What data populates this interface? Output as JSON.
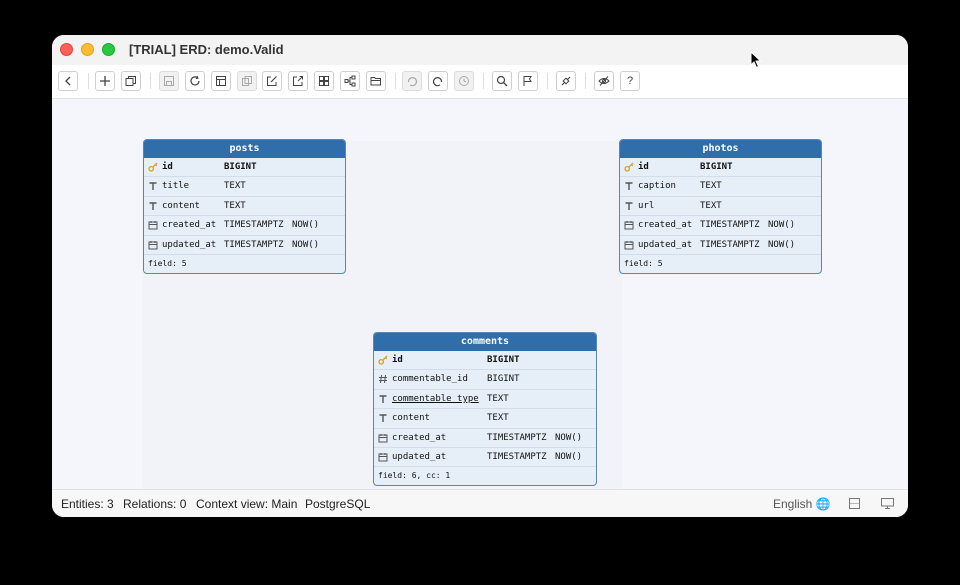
{
  "window": {
    "title": "[TRIAL] ERD: demo.Valid"
  },
  "toolbar": {
    "buttons": [
      "back",
      "add",
      "copy",
      "save",
      "refresh",
      "layout",
      "duplicate",
      "edit",
      "export",
      "grid",
      "tree",
      "open",
      "undo",
      "redo",
      "history",
      "search",
      "flag",
      "link",
      "hide",
      "help"
    ]
  },
  "entities": [
    {
      "name": "posts",
      "fields": [
        {
          "icon": "key-icon",
          "name": "id",
          "type": "BIGINT",
          "default": "",
          "pk": true
        },
        {
          "icon": "text-type-icon",
          "name": "title",
          "type": "TEXT",
          "default": ""
        },
        {
          "icon": "text-type-icon",
          "name": "content",
          "type": "TEXT",
          "default": ""
        },
        {
          "icon": "calendar-icon",
          "name": "created_at",
          "type": "TIMESTAMPTZ",
          "default": "NOW()"
        },
        {
          "icon": "calendar-icon",
          "name": "updated_at",
          "type": "TIMESTAMPTZ",
          "default": "NOW()"
        }
      ],
      "footer": "field: 5"
    },
    {
      "name": "photos",
      "fields": [
        {
          "icon": "key-icon",
          "name": "id",
          "type": "BIGINT",
          "default": "",
          "pk": true
        },
        {
          "icon": "text-type-icon",
          "name": "caption",
          "type": "TEXT",
          "default": ""
        },
        {
          "icon": "text-type-icon",
          "name": "url",
          "type": "TEXT",
          "default": ""
        },
        {
          "icon": "calendar-icon",
          "name": "created_at",
          "type": "TIMESTAMPTZ",
          "default": "NOW()"
        },
        {
          "icon": "calendar-icon",
          "name": "updated_at",
          "type": "TIMESTAMPTZ",
          "default": "NOW()"
        }
      ],
      "footer": "field: 5"
    },
    {
      "name": "comments",
      "fields": [
        {
          "icon": "key-icon",
          "name": "id",
          "type": "BIGINT",
          "default": "",
          "pk": true
        },
        {
          "icon": "hash-icon",
          "name": "commentable_id",
          "type": "BIGINT",
          "default": ""
        },
        {
          "icon": "text-type-icon",
          "name": "commentable_type",
          "type": "TEXT",
          "default": "",
          "underline": true
        },
        {
          "icon": "text-type-icon",
          "name": "content",
          "type": "TEXT",
          "default": ""
        },
        {
          "icon": "calendar-icon",
          "name": "created_at",
          "type": "TIMESTAMPTZ",
          "default": "NOW()"
        },
        {
          "icon": "calendar-icon",
          "name": "updated_at",
          "type": "TIMESTAMPTZ",
          "default": "NOW()"
        }
      ],
      "footer": "field: 6, cc: 1"
    }
  ],
  "status": {
    "entities": "Entities: 3",
    "relations": "Relations: 0",
    "context": "Context view: Main",
    "db": "PostgreSQL",
    "language": "English"
  },
  "colors": {
    "header": "#2f6eab",
    "entity_bg": "#e6eef7",
    "key": "#e0a020"
  }
}
